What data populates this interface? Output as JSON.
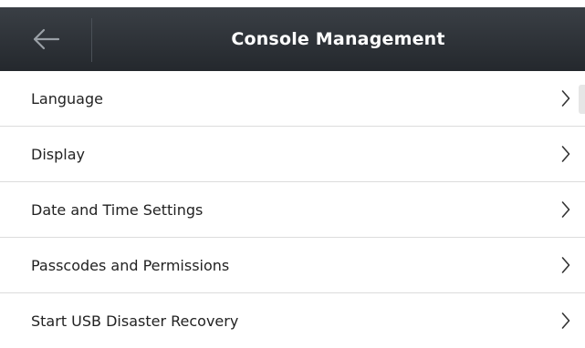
{
  "header": {
    "title": "Console Management",
    "back_icon": "arrow-left-icon"
  },
  "menu": {
    "items": [
      {
        "label": "Language",
        "icon": "chevron-right-icon"
      },
      {
        "label": "Display",
        "icon": "chevron-right-icon"
      },
      {
        "label": "Date and Time Settings",
        "icon": "chevron-right-icon"
      },
      {
        "label": "Passcodes and Permissions",
        "icon": "chevron-right-icon"
      },
      {
        "label": "Start USB Disaster Recovery",
        "icon": "chevron-right-icon"
      }
    ]
  },
  "colors": {
    "header_bg": "#2b3035",
    "header_text": "#ffffff",
    "back_icon": "#9aa0a6",
    "row_text": "#222222",
    "separator": "#dcdcdc"
  }
}
